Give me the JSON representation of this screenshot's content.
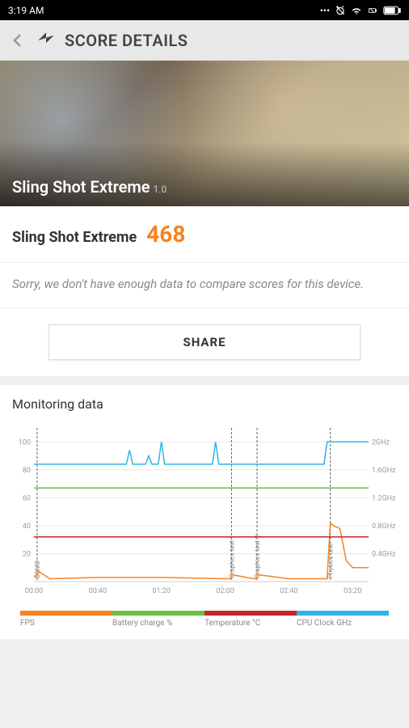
{
  "status": {
    "time": "3:19 AM",
    "icons": [
      "dots",
      "alarm-off",
      "wifi",
      "battery-box",
      "battery"
    ]
  },
  "header": {
    "title": "SCORE DETAILS"
  },
  "hero": {
    "title": "Sling Shot Extreme",
    "version": "1.0"
  },
  "score": {
    "label": "Sling Shot Extreme",
    "value": "468"
  },
  "message": {
    "text": "Sorry, we don't have enough data to compare scores for this device."
  },
  "share": {
    "label": "SHARE"
  },
  "monitoring": {
    "title": "Monitoring data"
  },
  "chart_data": {
    "type": "line",
    "title": "Monitoring data",
    "xlabel": "",
    "ylabel_left": "",
    "ylabel_right": "",
    "x_ticks": [
      "00:00",
      "00:40",
      "01:20",
      "02:00",
      "02:40",
      "03:20"
    ],
    "y_left_ticks": [
      "20",
      "40",
      "60",
      "80",
      "100"
    ],
    "y_right_ticks": [
      "0.4GHz",
      "0.8GHz",
      "1.2GHz",
      "1.6GHz",
      "2GHz"
    ],
    "markers": [
      {
        "label": "DEMO",
        "x": 2
      },
      {
        "label": "Graphics test 1",
        "x": 124
      },
      {
        "label": "Graphics test 2",
        "x": 140
      },
      {
        "label": "Physics test",
        "x": 186
      }
    ],
    "series": [
      {
        "name": "FPS",
        "color": "#f58220",
        "y_axis": "left",
        "values": [
          [
            0,
            4
          ],
          [
            2,
            4
          ],
          [
            2,
            8
          ],
          [
            10,
            2
          ],
          [
            40,
            3
          ],
          [
            80,
            3
          ],
          [
            120,
            2
          ],
          [
            124,
            2
          ],
          [
            124,
            5
          ],
          [
            138,
            2
          ],
          [
            140,
            2
          ],
          [
            140,
            5
          ],
          [
            160,
            2
          ],
          [
            184,
            2
          ],
          [
            186,
            42
          ],
          [
            188,
            40
          ],
          [
            192,
            38
          ],
          [
            196,
            15
          ],
          [
            200,
            10
          ],
          [
            210,
            10
          ]
        ]
      },
      {
        "name": "Battery charge %",
        "color": "#6fbf44",
        "y_axis": "left",
        "values": [
          [
            0,
            67
          ],
          [
            210,
            67
          ]
        ]
      },
      {
        "name": "Temperature °C",
        "color": "#c1272d",
        "y_axis": "left",
        "values": [
          [
            0,
            32
          ],
          [
            210,
            32
          ]
        ]
      },
      {
        "name": "CPU Clock GHz",
        "color": "#2fb4e6",
        "y_axis": "right",
        "values": [
          [
            0,
            1.68
          ],
          [
            58,
            1.68
          ],
          [
            60,
            1.88
          ],
          [
            62,
            1.68
          ],
          [
            70,
            1.68
          ],
          [
            72,
            1.8
          ],
          [
            74,
            1.68
          ],
          [
            78,
            1.68
          ],
          [
            80,
            2.0
          ],
          [
            82,
            1.68
          ],
          [
            112,
            1.68
          ],
          [
            114,
            2.0
          ],
          [
            116,
            1.68
          ],
          [
            182,
            1.68
          ],
          [
            184,
            2.0
          ],
          [
            186,
            2.0
          ],
          [
            210,
            2.0
          ]
        ]
      }
    ],
    "y_left_range": [
      0,
      110
    ],
    "y_right_range": [
      0,
      2.2
    ],
    "x_range": [
      0,
      210
    ]
  },
  "legend": [
    {
      "label": "FPS",
      "color": "#f58220"
    },
    {
      "label": "Battery charge %",
      "color": "#6fbf44"
    },
    {
      "label": "Temperature °C",
      "color": "#c1272d"
    },
    {
      "label": "CPU Clock GHz",
      "color": "#2fb4e6"
    }
  ]
}
